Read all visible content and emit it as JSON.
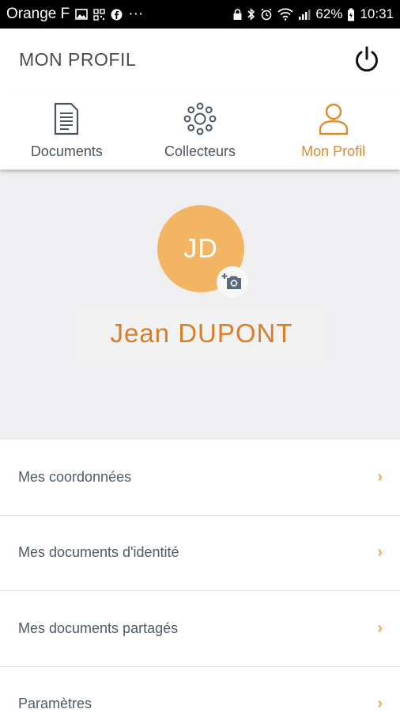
{
  "status_bar": {
    "carrier": "Orange F",
    "left_icons": [
      "image-icon",
      "qr-code-icon",
      "facebook-icon",
      "more-icon"
    ],
    "more": "···",
    "right_icons": [
      "lock-icon",
      "bluetooth-icon",
      "alarm-icon",
      "wifi-icon",
      "signal-icon"
    ],
    "battery": "62%",
    "time": "10:31"
  },
  "header": {
    "title": "MON PROFIL",
    "power_icon": "power-icon"
  },
  "tabs": [
    {
      "label": "Documents",
      "icon": "document-icon",
      "active": false
    },
    {
      "label": "Collecteurs",
      "icon": "collectors-icon",
      "active": false
    },
    {
      "label": "Mon Profil",
      "icon": "user-icon",
      "active": true
    }
  ],
  "profile": {
    "initials": "JD",
    "name": "Jean DUPONT",
    "camera_icon": "add-photo-icon"
  },
  "menu": [
    {
      "label": "Mes coordonnées",
      "chevron": "›"
    },
    {
      "label": "Mes documents d'identité",
      "chevron": "›"
    },
    {
      "label": "Mes documents partagés",
      "chevron": "›"
    },
    {
      "label": "Paramètres",
      "chevron": "›"
    }
  ],
  "colors": {
    "accent": "#e08a2d",
    "avatar": "#f2b563",
    "name": "#d57f2a",
    "chevron": "#e7a94a",
    "tab_inactive": "#4a5560",
    "profile_bg": "#efeff1"
  }
}
